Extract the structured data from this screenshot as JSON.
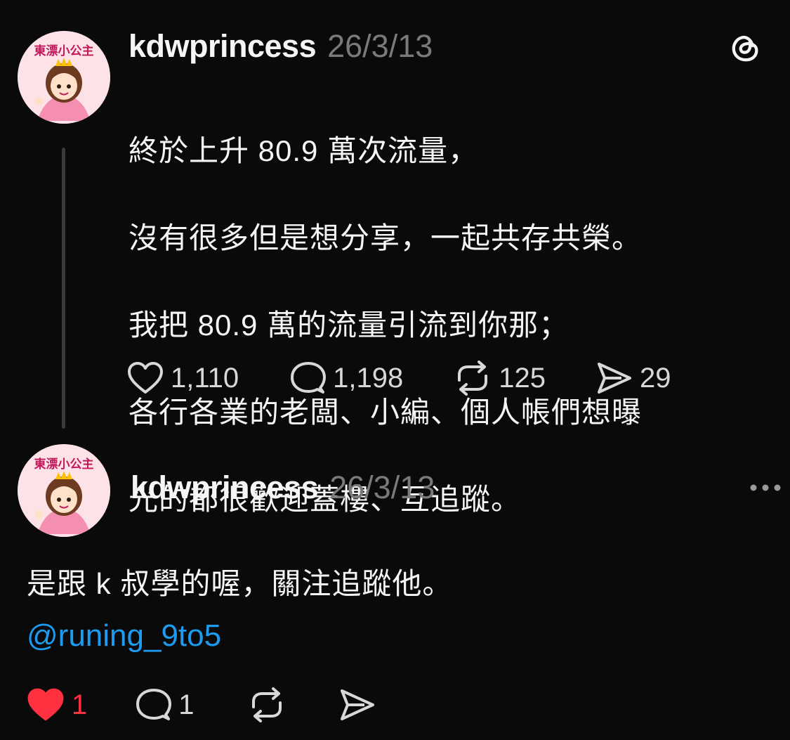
{
  "post": {
    "username": "kdwprincess",
    "date": "26/3/13",
    "avatar_text": "東漂小公主",
    "lines": [
      "終於上升 80.9 萬次流量，",
      "沒有很多但是想分享，一起共存共榮。",
      "我把 80.9 萬的流量引流到你那；",
      "各行各業的老闆、小編、個人帳們想曝",
      "光的都很歡迎蓋樓、互追蹤。"
    ],
    "likes": "1,110",
    "replies": "1,198",
    "reposts": "125",
    "shares": "29"
  },
  "reply": {
    "username": "kdwprincess",
    "date": "26/3/13",
    "avatar_text": "東漂小公主",
    "text": "是跟 k 叔學的喔，關注追蹤他。",
    "mention": "@runing_9to5",
    "likes": "1",
    "replies": "1",
    "like_color": "#ff3040"
  },
  "icons": {
    "app": "threads-logo-icon",
    "more": "more-horizontal-icon",
    "like": "heart-icon",
    "reply": "comment-icon",
    "repost": "repost-icon",
    "share": "share-icon"
  }
}
